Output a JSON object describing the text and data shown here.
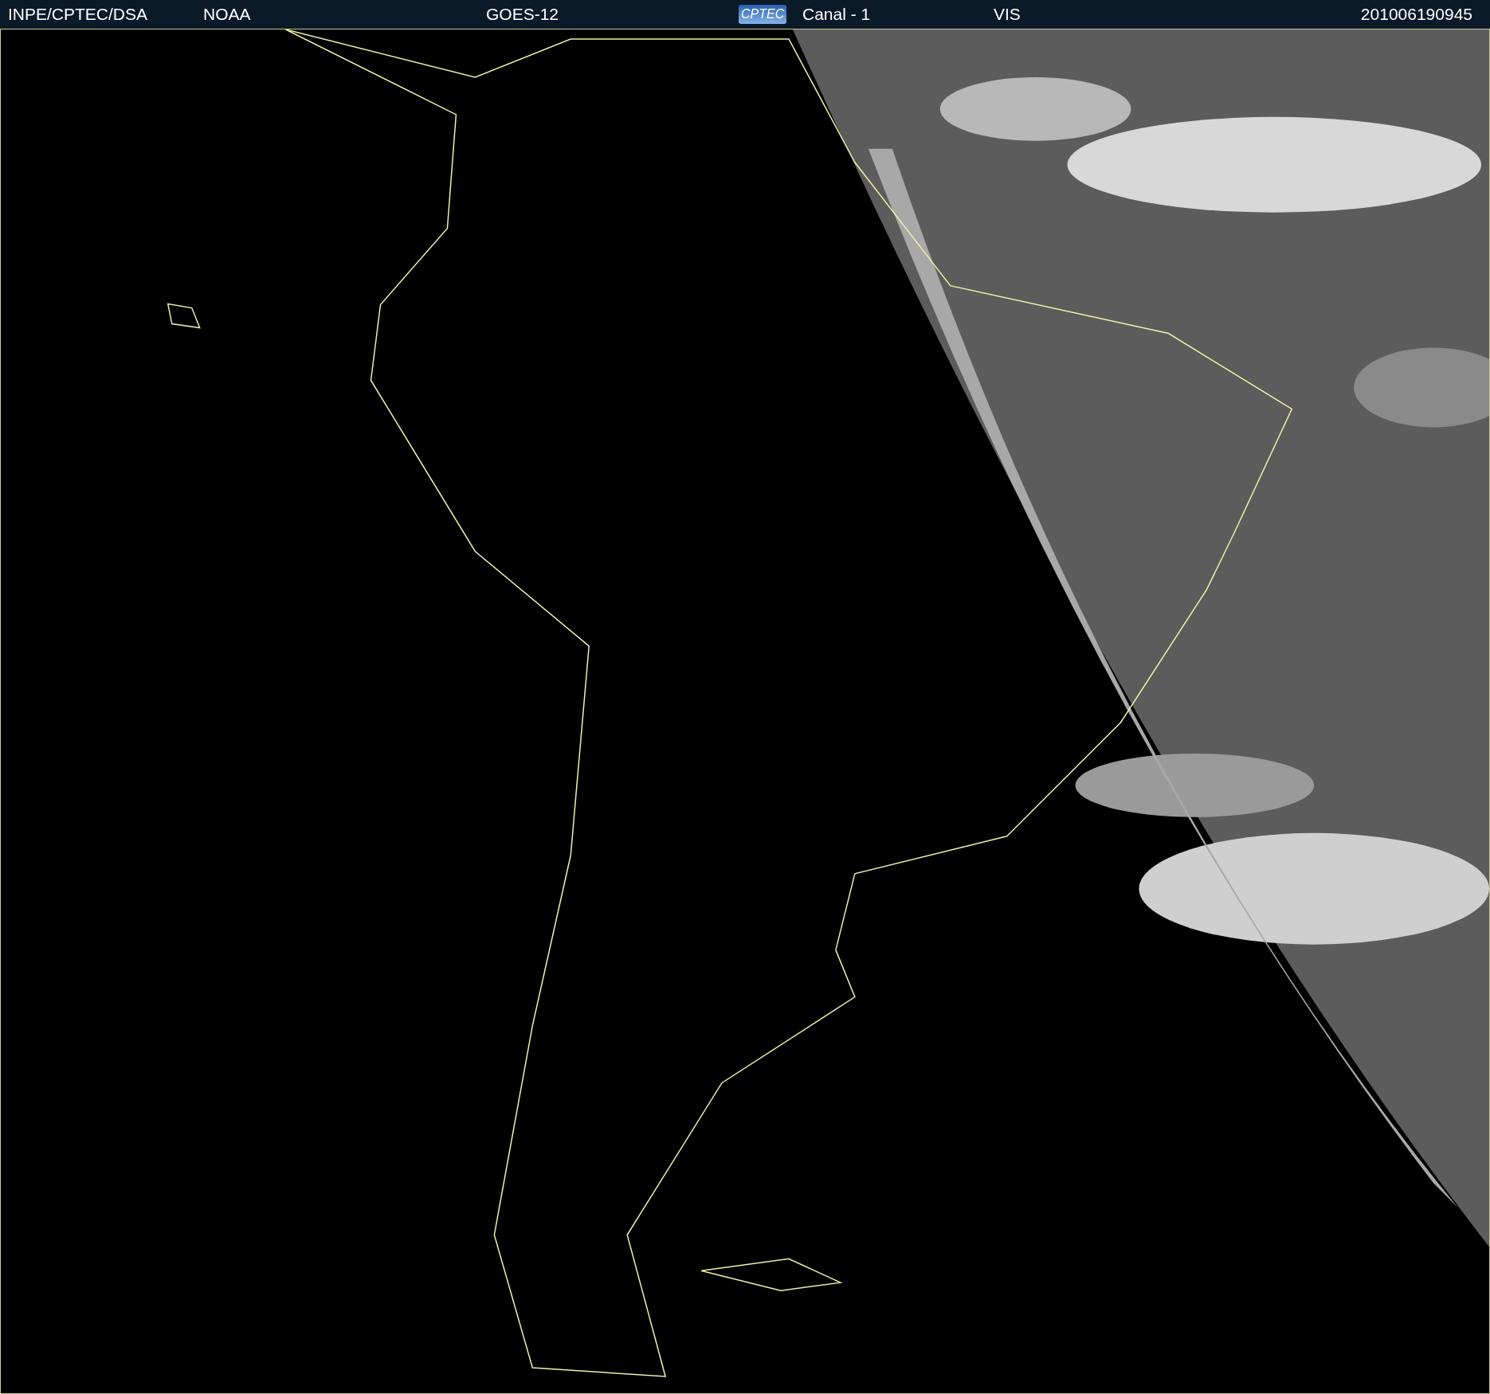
{
  "header": {
    "items": [
      {
        "kind": "text",
        "text": "INPE/CPTEC/DSA"
      },
      {
        "kind": "text",
        "text": "NOAA"
      },
      {
        "kind": "text",
        "text": "GOES-12"
      },
      {
        "kind": "logo",
        "text": "CPTEC"
      },
      {
        "kind": "text",
        "text": "Canal - 1"
      },
      {
        "kind": "text",
        "text": "VIS"
      },
      {
        "kind": "text",
        "text": "201006190945"
      }
    ]
  }
}
